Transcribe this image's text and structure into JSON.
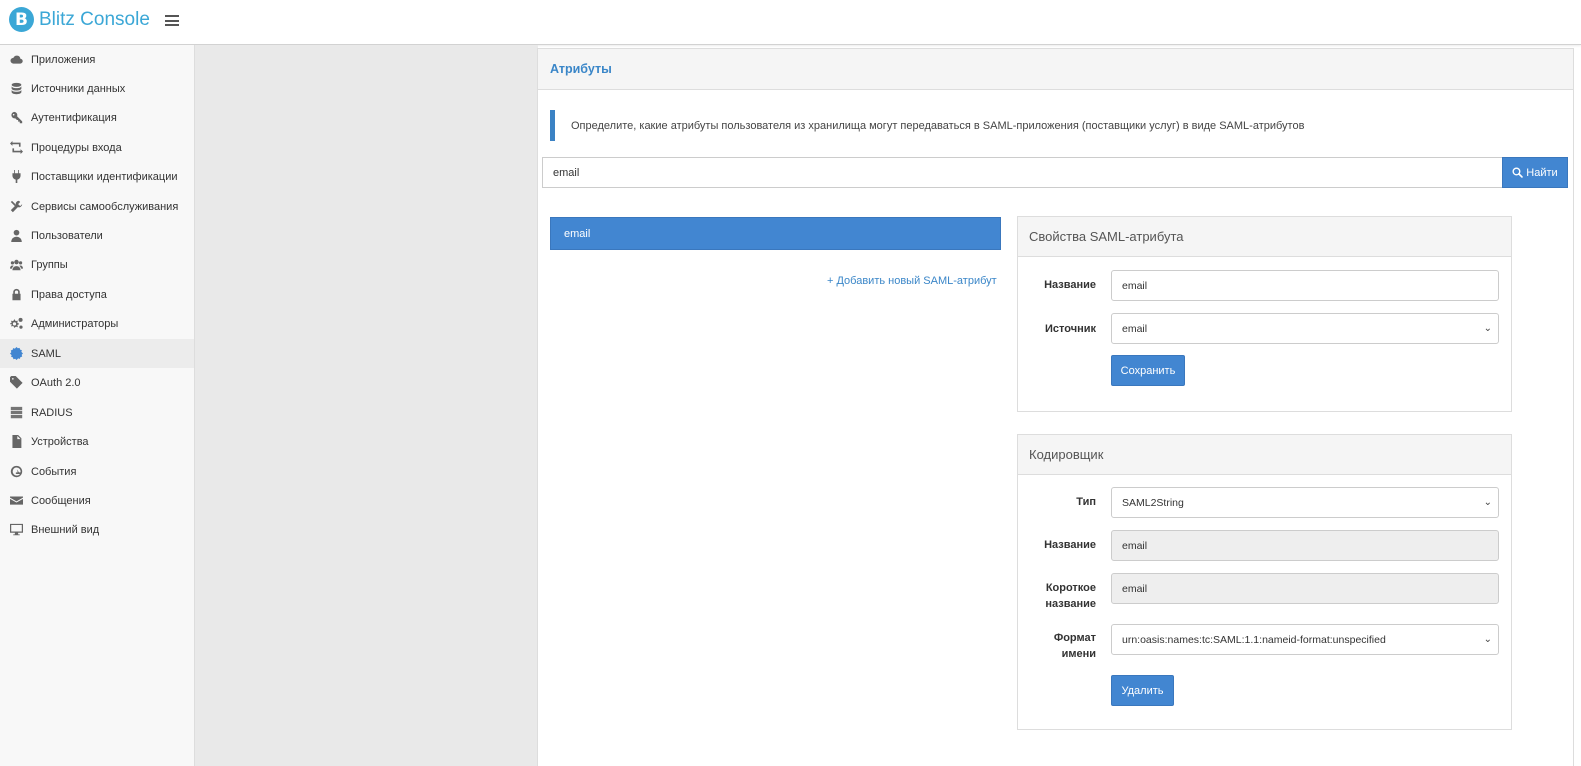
{
  "app": {
    "title": "Blitz Console",
    "logo_letter": "B"
  },
  "sidebar": {
    "items": [
      {
        "label": "Приложения",
        "icon": "cloud-icon"
      },
      {
        "label": "Источники данных",
        "icon": "database-icon"
      },
      {
        "label": "Аутентификация",
        "icon": "key-icon"
      },
      {
        "label": "Процедуры входа",
        "icon": "retweet-icon"
      },
      {
        "label": "Поставщики идентификации",
        "icon": "plug-icon"
      },
      {
        "label": "Сервисы самообслуживания",
        "icon": "wrench-icon"
      },
      {
        "label": "Пользователи",
        "icon": "user-icon"
      },
      {
        "label": "Группы",
        "icon": "users-icon"
      },
      {
        "label": "Права доступа",
        "icon": "lock-icon"
      },
      {
        "label": "Администраторы",
        "icon": "cogs-icon"
      },
      {
        "label": "SAML",
        "icon": "certificate-icon",
        "active": true
      },
      {
        "label": "OAuth 2.0",
        "icon": "tag-icon"
      },
      {
        "label": "RADIUS",
        "icon": "server-icon"
      },
      {
        "label": "Устройства",
        "icon": "device-icon"
      },
      {
        "label": "События",
        "icon": "dashboard-icon"
      },
      {
        "label": "Сообщения",
        "icon": "envelope-icon"
      },
      {
        "label": "Внешний вид",
        "icon": "desktop-icon"
      }
    ]
  },
  "main": {
    "title": "Атрибуты",
    "info": "Определите, какие атрибуты пользователя из хранилища могут передаваться в SAML-приложения (поставщики услуг) в виде SAML-атрибутов",
    "search": {
      "value": "email",
      "button_label": "Найти"
    },
    "attributes": [
      "email"
    ],
    "add_link": "+ Добавить новый SAML-атрибут"
  },
  "properties": {
    "title": "Свойства SAML-атрибута",
    "name_label": "Название",
    "name_value": "email",
    "source_label": "Источник",
    "source_value": "email",
    "save_label": "Сохранить"
  },
  "encoder": {
    "title": "Кодировщик",
    "type_label": "Тип",
    "type_value": "SAML2String",
    "name_label": "Название",
    "name_value": "email",
    "short_label_1": "Короткое",
    "short_label_2": "название",
    "short_value": "email",
    "format_label_1": "Формат",
    "format_label_2": "имени",
    "format_value": "urn:oasis:names:tc:SAML:1.1:nameid-format:unspecified",
    "delete_label": "Удалить"
  },
  "colors": {
    "accent": "#4286d1",
    "brand": "#3ba7d6"
  }
}
